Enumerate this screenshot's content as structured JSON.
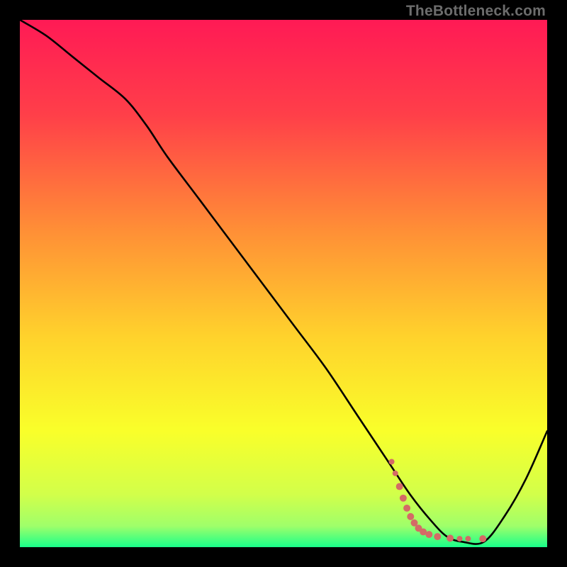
{
  "watermark": "TheBottleneck.com",
  "chart_data": {
    "type": "line",
    "title": "",
    "xlabel": "",
    "ylabel": "",
    "xlim": [
      0,
      100
    ],
    "ylim": [
      0,
      100
    ],
    "gradient_stops": [
      {
        "pct": 0,
        "color": "#ff1a55"
      },
      {
        "pct": 18,
        "color": "#ff3f49"
      },
      {
        "pct": 40,
        "color": "#ff8f36"
      },
      {
        "pct": 60,
        "color": "#ffd22c"
      },
      {
        "pct": 78,
        "color": "#f9ff2a"
      },
      {
        "pct": 90,
        "color": "#d2ff4a"
      },
      {
        "pct": 96,
        "color": "#9fff6a"
      },
      {
        "pct": 100,
        "color": "#19ff8a"
      }
    ],
    "series": [
      {
        "name": "bottleneck-curve",
        "color": "#000000",
        "width": 2,
        "x": [
          0,
          5,
          10,
          15,
          20,
          24,
          28,
          34,
          40,
          46,
          52,
          58,
          64,
          70,
          74,
          78,
          81,
          84,
          88,
          92,
          96,
          100
        ],
        "y": [
          100,
          97,
          93,
          89,
          85,
          80,
          74,
          66,
          58,
          50,
          42,
          34,
          25,
          16,
          10,
          5,
          2,
          1,
          1,
          6,
          13,
          22
        ]
      },
      {
        "name": "sample-dots",
        "color": "#d46a66",
        "type": "scatter",
        "points": [
          {
            "x": 70.5,
            "y": 16.2,
            "r": 4
          },
          {
            "x": 71.2,
            "y": 14.0,
            "r": 4
          },
          {
            "x": 72.0,
            "y": 11.5,
            "r": 5
          },
          {
            "x": 72.7,
            "y": 9.3,
            "r": 5
          },
          {
            "x": 73.4,
            "y": 7.4,
            "r": 5
          },
          {
            "x": 74.1,
            "y": 5.8,
            "r": 5
          },
          {
            "x": 74.8,
            "y": 4.6,
            "r": 5
          },
          {
            "x": 75.6,
            "y": 3.6,
            "r": 5
          },
          {
            "x": 76.5,
            "y": 2.9,
            "r": 5
          },
          {
            "x": 77.6,
            "y": 2.4,
            "r": 5
          },
          {
            "x": 79.2,
            "y": 2.0,
            "r": 5
          },
          {
            "x": 81.6,
            "y": 1.7,
            "r": 5
          },
          {
            "x": 83.4,
            "y": 1.6,
            "r": 4
          },
          {
            "x": 85.0,
            "y": 1.6,
            "r": 4
          },
          {
            "x": 87.8,
            "y": 1.6,
            "r": 5
          }
        ]
      }
    ]
  }
}
